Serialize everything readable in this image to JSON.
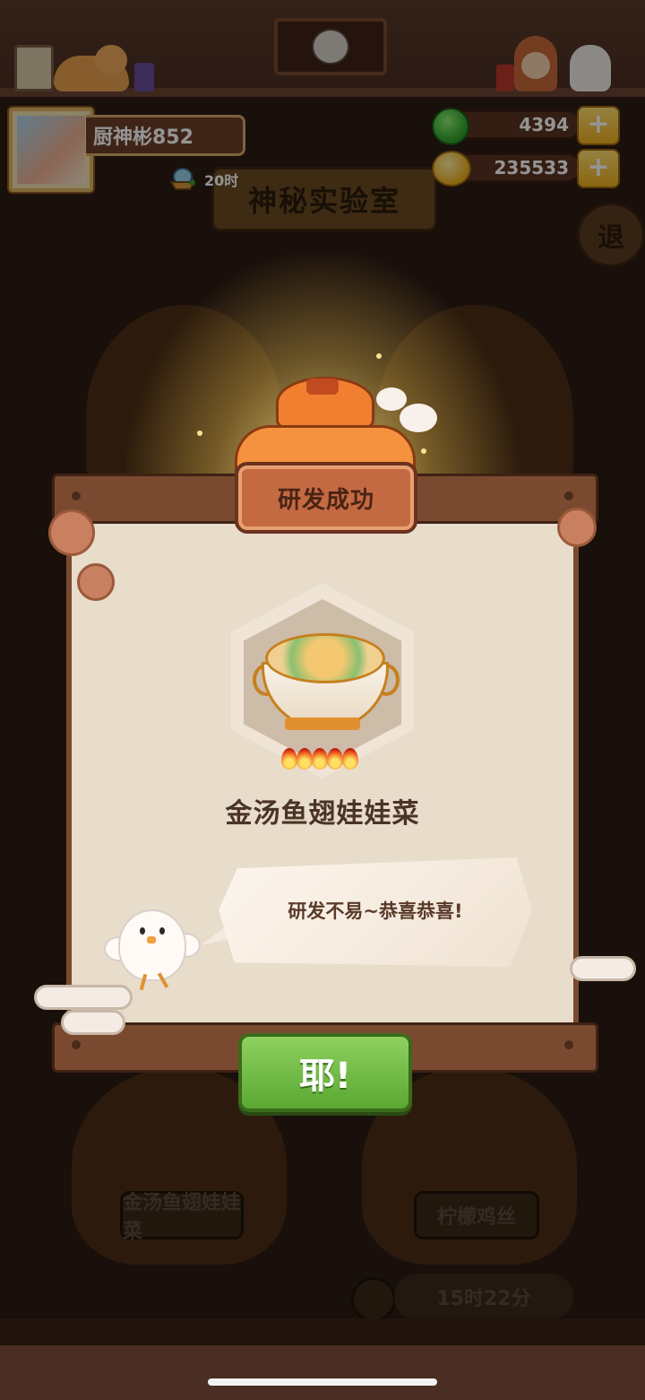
{
  "background": {
    "lab_title": "神秘实验室",
    "exit_label": "退",
    "pots": [
      {
        "dish_label": "金汤鱼翅娃娃菜"
      },
      {
        "dish_label": "柠檬鸡丝"
      }
    ],
    "timer_text": "15时22分"
  },
  "player": {
    "name": "厨神彬852",
    "boat_timer": "20时"
  },
  "resources": [
    {
      "icon": "jade-icon",
      "value": "4394"
    },
    {
      "icon": "coin-icon",
      "value": "235533"
    }
  ],
  "dialog": {
    "title": "研发成功",
    "dish_name": "金汤鱼翅娃娃菜",
    "flame_count": 5,
    "speech": "研发不易~恭喜恭喜!",
    "confirm_label": "耶!"
  },
  "colors": {
    "wood": "#7a4a30",
    "paper": "#e8dccb",
    "confirm_green": "#5aa832",
    "title_plate": "#c46a42"
  }
}
